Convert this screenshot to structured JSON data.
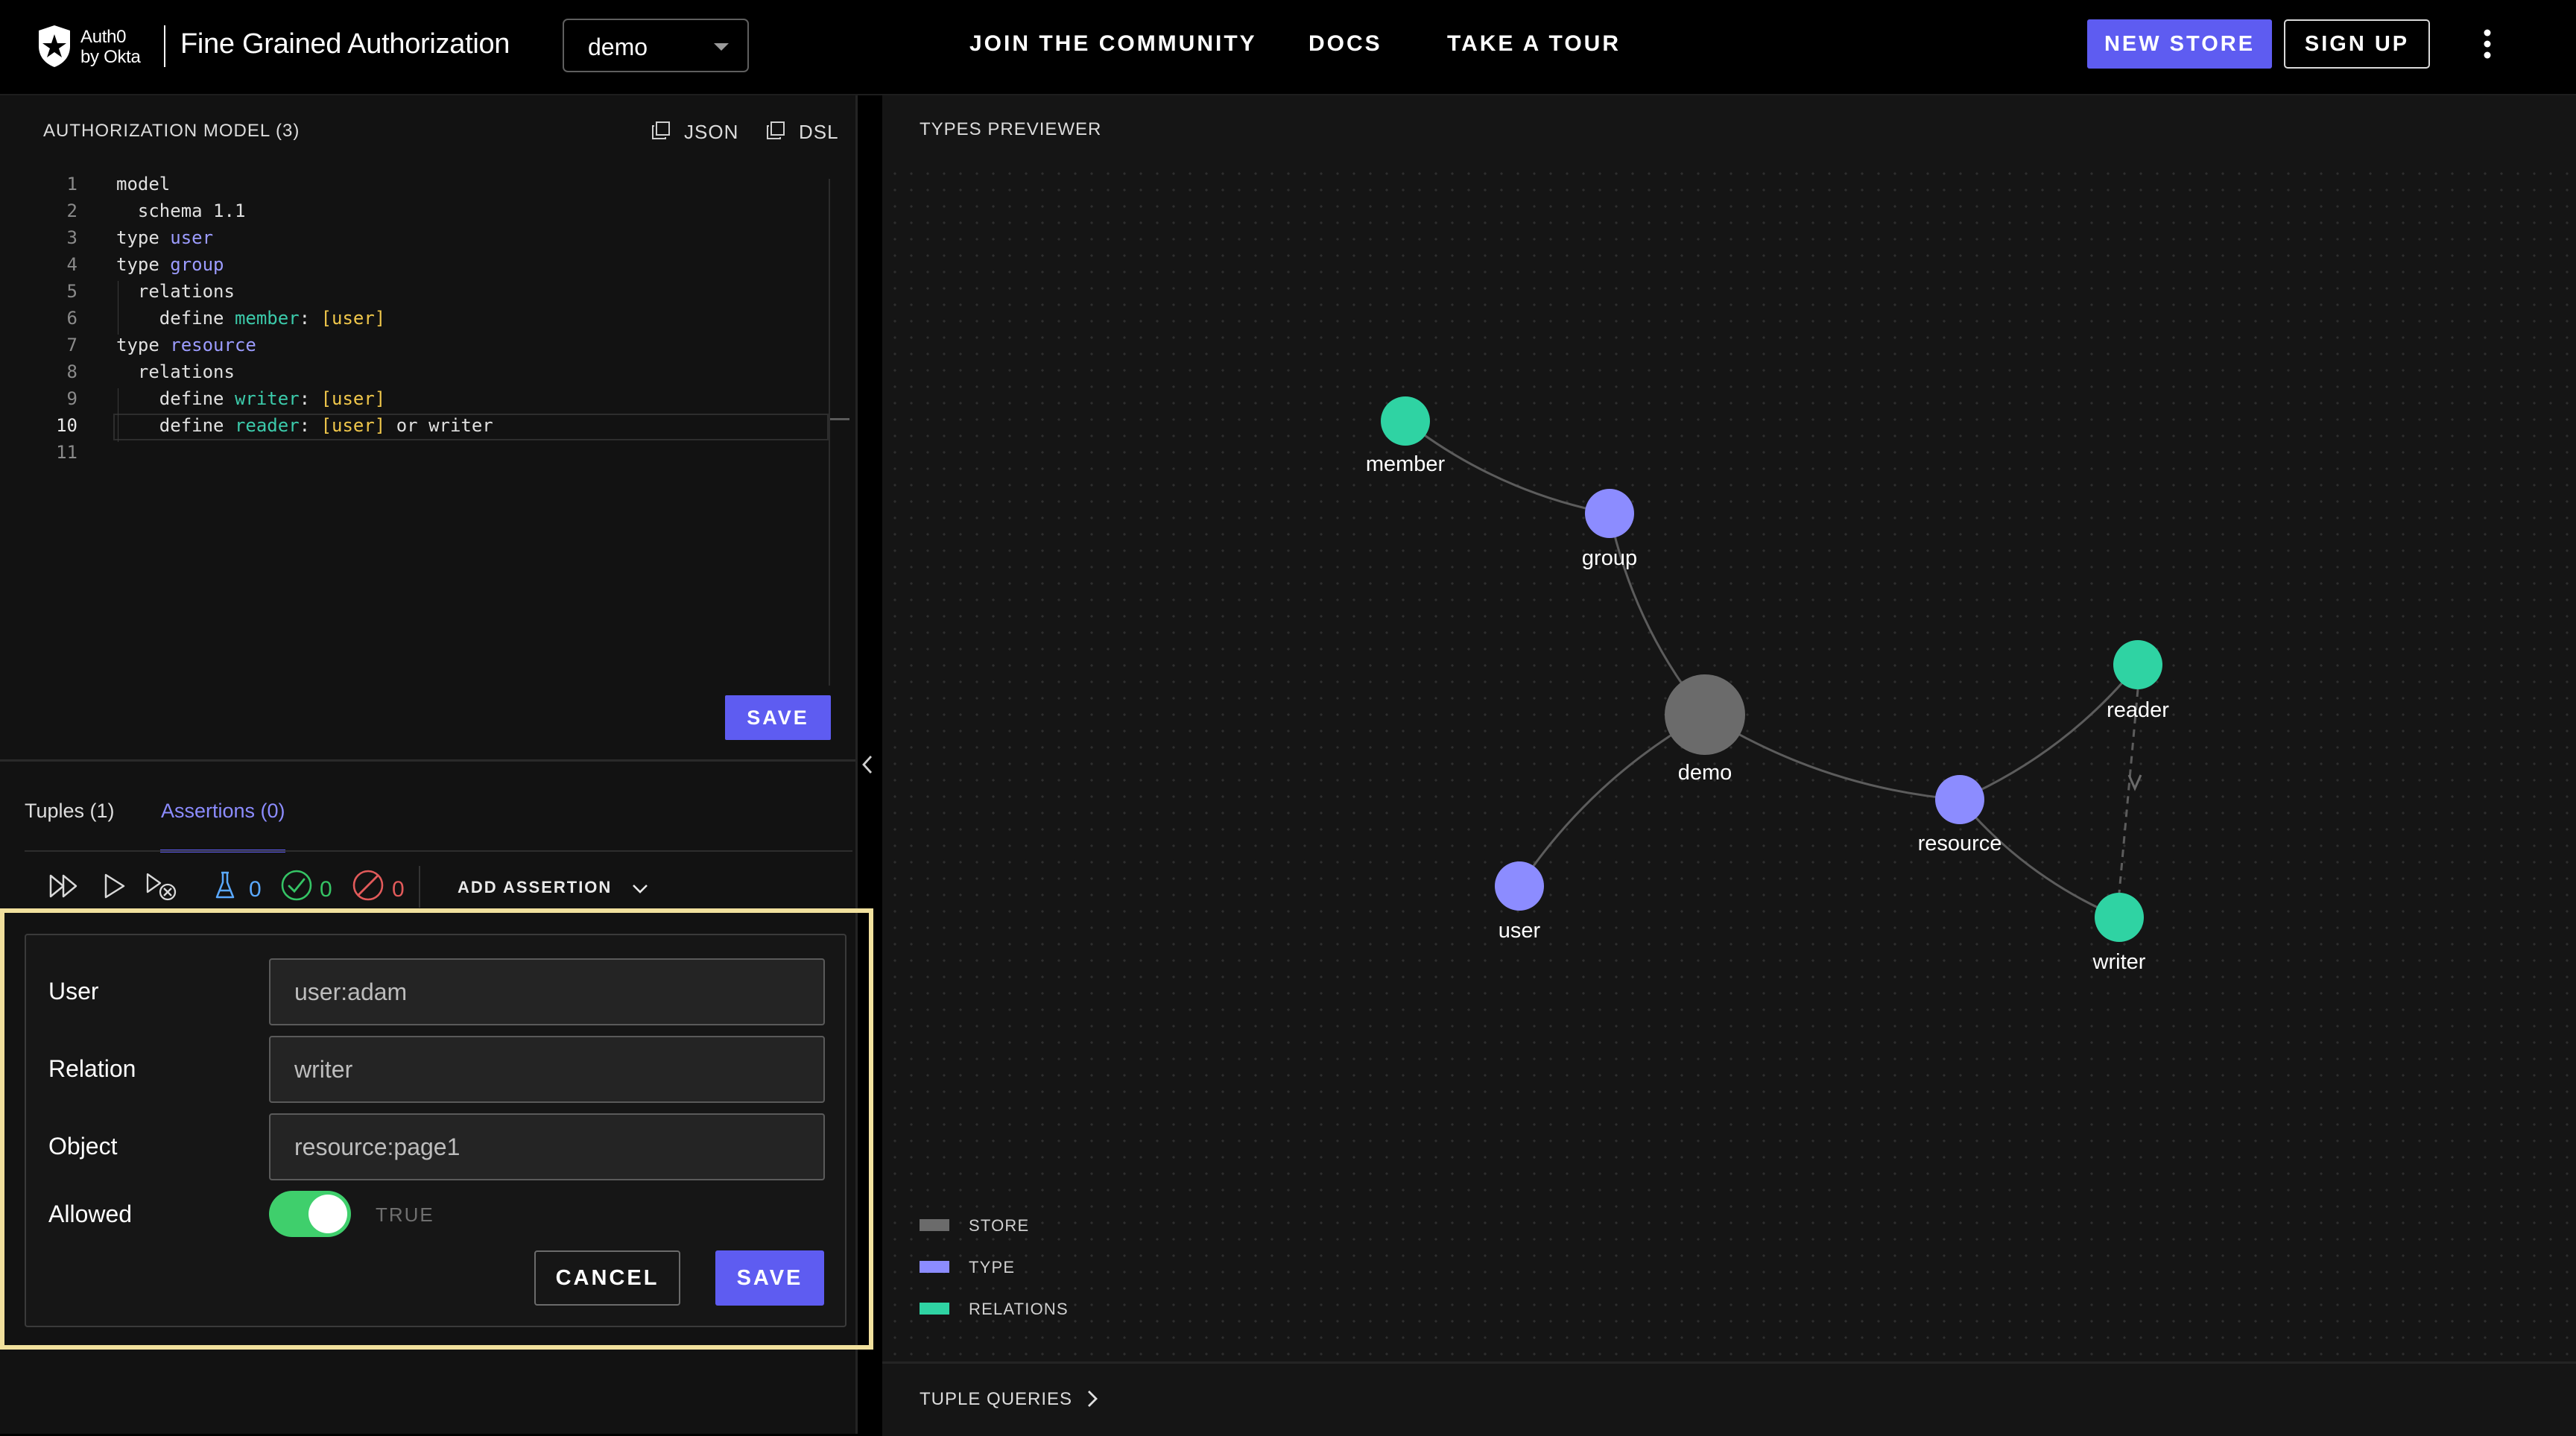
{
  "header": {
    "logo_line1": "Auth0",
    "logo_line2": "by Okta",
    "app_title": "Fine Grained Authorization",
    "store_selected": "demo",
    "nav": [
      "JOIN  THE COMMUNITY",
      "DOCS",
      "TAKE  A  TOUR"
    ],
    "new_store_label": "NEW STORE",
    "sign_up_label": "SIGN UP",
    "icons": {
      "logo": "auth0-shield-icon",
      "store_dropdown": "chevron-down-icon",
      "more": "vertical-dots-icon"
    }
  },
  "model_panel": {
    "title": "AUTHORIZATION MODEL (3)",
    "json_label": "JSON",
    "dsl_label": "DSL",
    "active_line": 10,
    "code": [
      {
        "n": "1",
        "parts": [
          {
            "t": "model",
            "c": ""
          }
        ]
      },
      {
        "n": "2",
        "parts": [
          {
            "t": "  schema ",
            "c": ""
          },
          {
            "t": "1.1",
            "c": ""
          }
        ]
      },
      {
        "n": "3",
        "parts": [
          {
            "t": "type ",
            "c": ""
          },
          {
            "t": "user",
            "c": "k-type"
          }
        ]
      },
      {
        "n": "4",
        "parts": [
          {
            "t": "type ",
            "c": ""
          },
          {
            "t": "group",
            "c": "k-type"
          }
        ]
      },
      {
        "n": "5",
        "parts": [
          {
            "t": "  relations",
            "c": ""
          }
        ]
      },
      {
        "n": "6",
        "parts": [
          {
            "t": "    define ",
            "c": ""
          },
          {
            "t": "member",
            "c": "k-rel"
          },
          {
            "t": ": ",
            "c": ""
          },
          {
            "t": "[user]",
            "c": "k-br"
          }
        ]
      },
      {
        "n": "7",
        "parts": [
          {
            "t": "type ",
            "c": ""
          },
          {
            "t": "resource",
            "c": "k-type"
          }
        ]
      },
      {
        "n": "8",
        "parts": [
          {
            "t": "  relations",
            "c": ""
          }
        ]
      },
      {
        "n": "9",
        "parts": [
          {
            "t": "    define ",
            "c": ""
          },
          {
            "t": "writer",
            "c": "k-rel"
          },
          {
            "t": ": ",
            "c": ""
          },
          {
            "t": "[user]",
            "c": "k-br"
          }
        ]
      },
      {
        "n": "10",
        "parts": [
          {
            "t": "    define ",
            "c": ""
          },
          {
            "t": "reader",
            "c": "k-rel"
          },
          {
            "t": ": ",
            "c": ""
          },
          {
            "t": "[user]",
            "c": "k-br"
          },
          {
            "t": " or writer",
            "c": ""
          }
        ]
      },
      {
        "n": "11",
        "parts": []
      }
    ],
    "save_label": "SAVE"
  },
  "bottom_panel": {
    "tabs": [
      "Tuples (1)",
      "Assertions (0)"
    ],
    "active_tab": 1,
    "counters": {
      "total": "0",
      "passed": "0",
      "failed": "0"
    },
    "add_assertion_label": "ADD ASSERTION",
    "form": {
      "user_label": "User",
      "user_value": "user:adam",
      "relation_label": "Relation",
      "relation_value": "writer",
      "object_label": "Object",
      "object_value": "resource:page1",
      "allowed_label": "Allowed",
      "allowed_on": true,
      "allowed_text": "TRUE",
      "cancel_label": "CANCEL",
      "save_label": "SAVE"
    }
  },
  "types_previewer": {
    "title": "TYPES PREVIEWER",
    "nodes": [
      {
        "id": "member",
        "label": "member",
        "kind": "relation"
      },
      {
        "id": "group",
        "label": "group",
        "kind": "type"
      },
      {
        "id": "demo",
        "label": "demo",
        "kind": "store"
      },
      {
        "id": "user",
        "label": "user",
        "kind": "type"
      },
      {
        "id": "resource",
        "label": "resource",
        "kind": "type"
      },
      {
        "id": "reader",
        "label": "reader",
        "kind": "relation"
      },
      {
        "id": "writer",
        "label": "writer",
        "kind": "relation"
      }
    ],
    "edges": [
      {
        "from": "member",
        "to": "group"
      },
      {
        "from": "group",
        "to": "demo"
      },
      {
        "from": "demo",
        "to": "user"
      },
      {
        "from": "demo",
        "to": "resource"
      },
      {
        "from": "resource",
        "to": "reader"
      },
      {
        "from": "resource",
        "to": "writer"
      },
      {
        "from": "reader",
        "to": "writer",
        "dashed": true
      }
    ],
    "legend": [
      {
        "label": "STORE",
        "color": "#6b6b6b"
      },
      {
        "label": "TYPE",
        "color": "#8c8cff"
      },
      {
        "label": "RELATIONS",
        "color": "#2fd3a3"
      }
    ],
    "tuple_queries_label": "TUPLE QUERIES"
  },
  "colors": {
    "accent": "#5e5cf1",
    "type_node": "#8c8cff",
    "relation_node": "#2fd3a3",
    "store_node": "#6b6b6b",
    "toggle_on": "#3fcf6c",
    "highlight_frame": "#f1e09d"
  }
}
